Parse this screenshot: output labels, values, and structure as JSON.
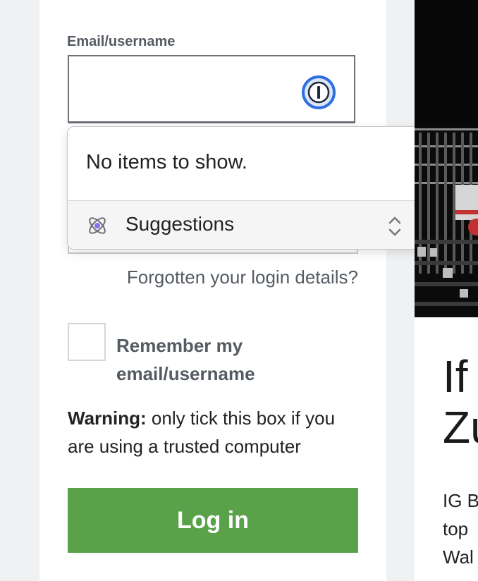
{
  "login_form": {
    "email_label": "Email/username",
    "email_value": "",
    "forgot_link": "Forgotten your login details?",
    "remember_checked": false,
    "remember_label": "Remember my email/username",
    "warning_strong": "Warning:",
    "warning_text": " only tick this box if you are using a trusted computer",
    "login_button": "Log in"
  },
  "autofill_popup": {
    "empty_message": "No items to show.",
    "suggestions_label": "Suggestions"
  },
  "icons": {
    "password_manager": "password-manager-icon",
    "suggestions": "suggestions-icon",
    "updown": "chevron-updown-icon"
  },
  "article": {
    "heading_partial": "If\nZu",
    "teaser_partial": "IG B\ntop \nWal"
  },
  "colors": {
    "primary_button": "#5aa24a",
    "pw_manager_accent": "#2f6fe0"
  }
}
